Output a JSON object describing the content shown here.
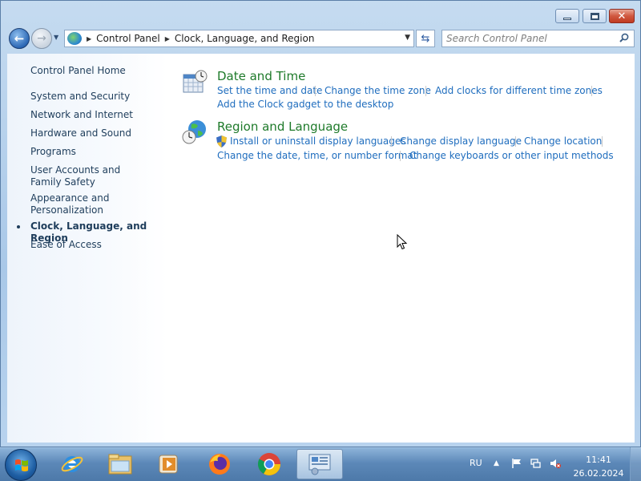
{
  "window": {
    "buttons": {
      "minimize": "minimize",
      "maximize": "maximize",
      "close": "close"
    }
  },
  "address_bar": {
    "path": [
      "Control Panel",
      "Clock, Language, and Region"
    ]
  },
  "search": {
    "placeholder": "Search Control Panel"
  },
  "sidebar": {
    "home": "Control Panel Home",
    "items": [
      {
        "label": "System and Security"
      },
      {
        "label": "Network and Internet"
      },
      {
        "label": "Hardware and Sound"
      },
      {
        "label": "Programs"
      },
      {
        "label": "User Accounts and Family Safety"
      },
      {
        "label": "Appearance and Personalization"
      },
      {
        "label": "Clock, Language, and Region",
        "active": true
      },
      {
        "label": "Ease of Access"
      }
    ]
  },
  "categories": [
    {
      "title": "Date and Time",
      "icon": "calendar-clock-icon",
      "links": [
        "Set the time and date",
        "Change the time zone",
        "Add clocks for different time zones",
        "Add the Clock gadget to the desktop"
      ]
    },
    {
      "title": "Region and Language",
      "icon": "globe-clock-icon",
      "links": [
        "Install or uninstall display languages",
        "Change display language",
        "Change location",
        "Change the date, time, or number format",
        "Change keyboards or other input methods"
      ]
    }
  ],
  "taskbar": {
    "apps": [
      "internet-explorer-icon",
      "file-explorer-icon",
      "media-player-icon",
      "firefox-icon",
      "chrome-icon",
      "control-panel-icon"
    ],
    "language": "RU",
    "time": "11:41",
    "date": "26.02.2024"
  },
  "colors": {
    "link": "#1f6dbe",
    "category_title": "#1e7a2a",
    "sidebar_text": "#1e3d5b"
  }
}
